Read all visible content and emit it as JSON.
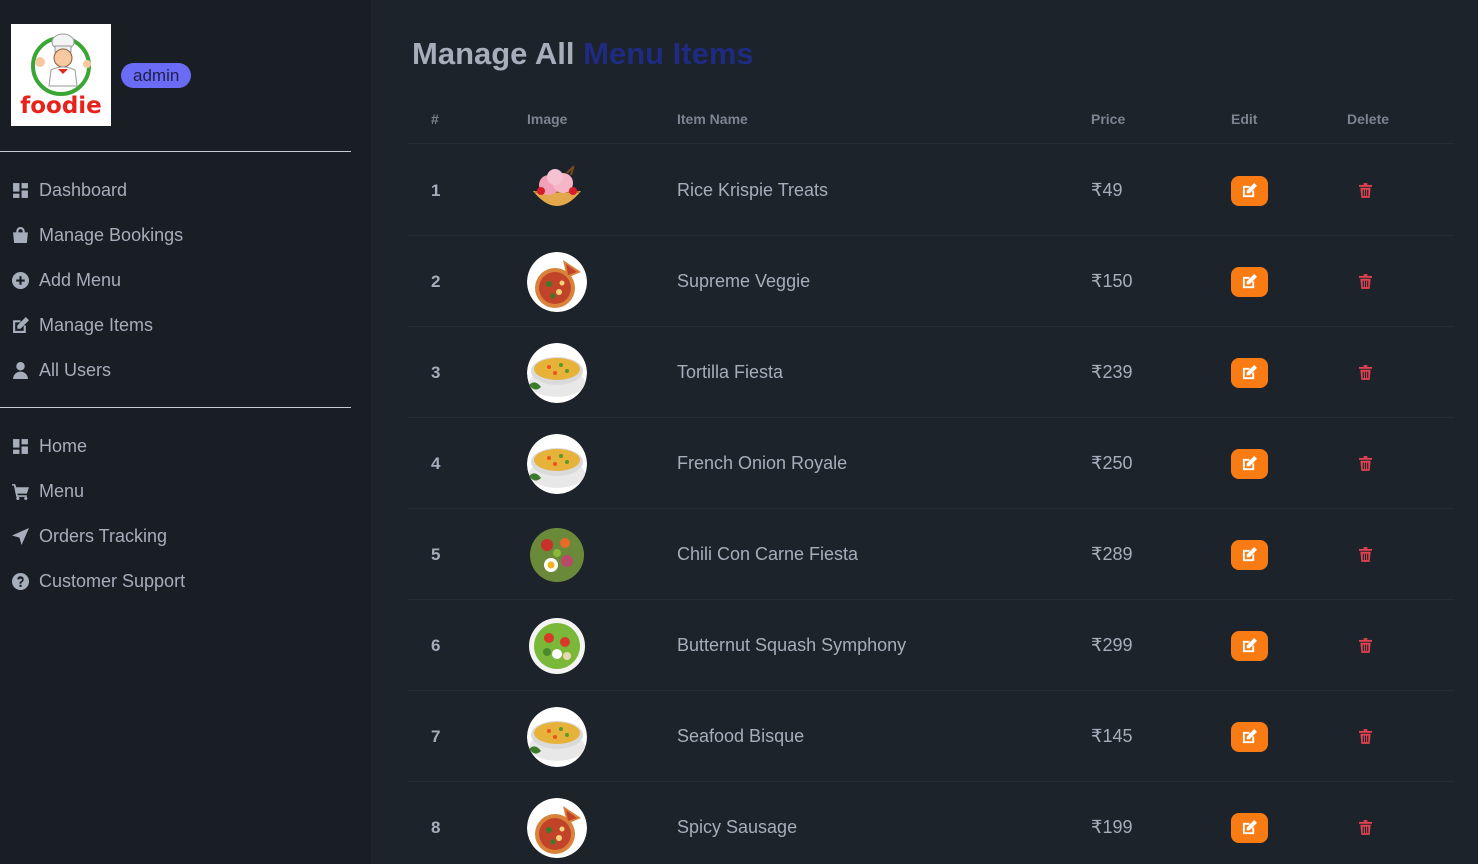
{
  "brand": {
    "logo_text": "foodie",
    "role_badge": "admin"
  },
  "sidebar": {
    "admin_items": [
      {
        "label": "Dashboard",
        "icon": "dashboard-icon"
      },
      {
        "label": "Manage Bookings",
        "icon": "shopping-bag-icon"
      },
      {
        "label": "Add Menu",
        "icon": "plus-circle-icon"
      },
      {
        "label": "Manage Items",
        "icon": "edit-icon"
      },
      {
        "label": "All Users",
        "icon": "user-icon"
      }
    ],
    "site_items": [
      {
        "label": "Home",
        "icon": "dashboard-icon"
      },
      {
        "label": "Menu",
        "icon": "cart-icon"
      },
      {
        "label": "Orders Tracking",
        "icon": "location-arrow-icon"
      },
      {
        "label": "Customer Support",
        "icon": "question-circle-icon"
      }
    ]
  },
  "page": {
    "title_prefix": "Manage All",
    "title_accent": "Menu Items"
  },
  "table": {
    "headers": [
      "#",
      "Image",
      "Item Name",
      "Price",
      "Edit",
      "Delete"
    ],
    "rows": [
      {
        "index": "1",
        "image": "ice-cream-bowl",
        "name": "Rice Krispie Treats",
        "price": "₹49"
      },
      {
        "index": "2",
        "image": "pizza",
        "name": "Supreme Veggie",
        "price": "₹150"
      },
      {
        "index": "3",
        "image": "soup-bowl",
        "name": "Tortilla Fiesta",
        "price": "₹239"
      },
      {
        "index": "4",
        "image": "soup-bowl",
        "name": "French Onion Royale",
        "price": "₹250"
      },
      {
        "index": "5",
        "image": "salad-with-egg",
        "name": "Chili Con Carne Fiesta",
        "price": "₹289"
      },
      {
        "index": "6",
        "image": "green-salad",
        "name": "Butternut Squash Symphony",
        "price": "₹299"
      },
      {
        "index": "7",
        "image": "soup-bowl",
        "name": "Seafood Bisque",
        "price": "₹145"
      },
      {
        "index": "8",
        "image": "pizza",
        "name": "Spicy Sausage",
        "price": "₹199"
      }
    ]
  },
  "colors": {
    "background": "#1d232a",
    "sidebar": "#191e24",
    "text": "#a6adbb",
    "title_accent": "#1e2b80",
    "badge": "#6a6cf5",
    "edit_button": "#f97b14",
    "delete_icon": "#e0434f"
  }
}
